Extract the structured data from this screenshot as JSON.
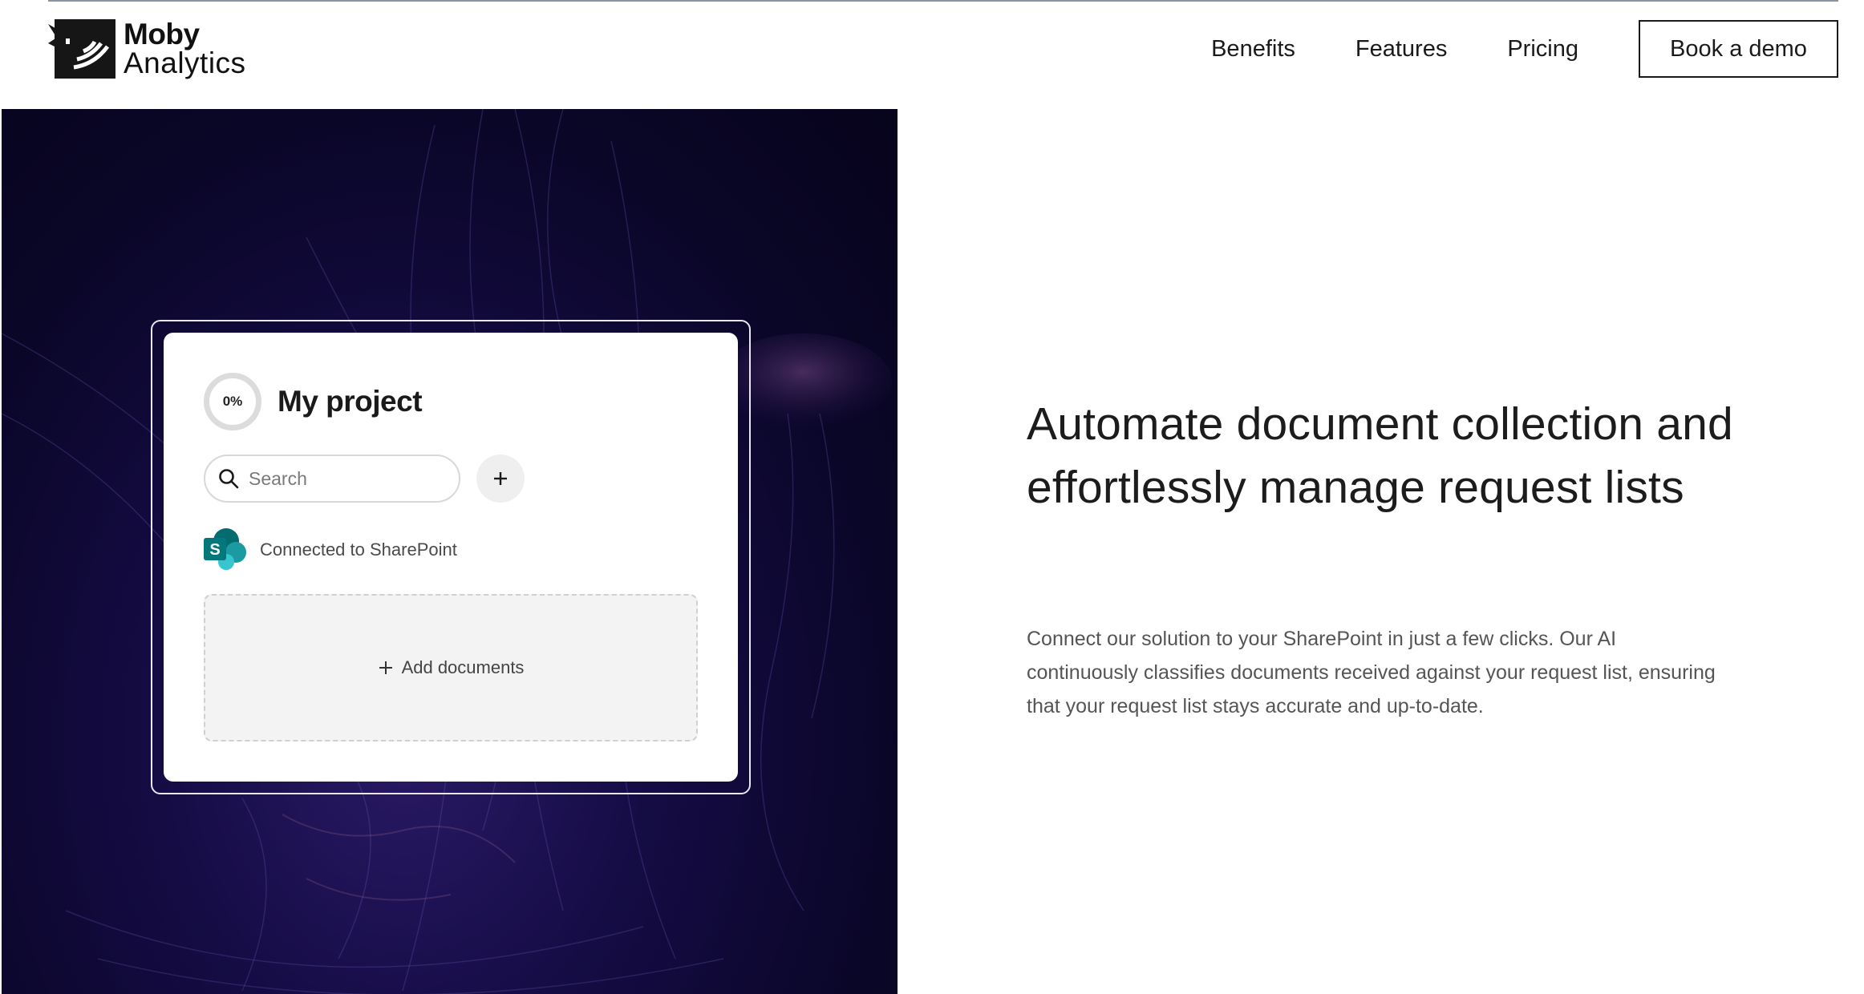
{
  "brand": {
    "name_line1": "Moby",
    "name_line2": "Analytics"
  },
  "nav": {
    "links": [
      "Benefits",
      "Features",
      "Pricing"
    ],
    "cta_label": "Book a demo"
  },
  "project_card": {
    "progress_label": "0%",
    "progress_value": 0,
    "title": "My project",
    "search_placeholder": "Search",
    "integration_status": "Connected to SharePoint",
    "add_documents_label": "Add documents"
  },
  "hero": {
    "headline": "Automate document collection and effortlessly manage request lists",
    "description": "Connect our solution to your SharePoint in just a few clicks. Our AI continuously classifies documents received against your request list, ensuring that your request list stays accurate and up-to-date."
  },
  "colors": {
    "background": "#ffffff",
    "hero_dark": "#0a0628",
    "hero_purple": "#2a1a66",
    "text_primary": "#1c1c1c",
    "text_secondary": "#555555",
    "sharepoint_teal": "#0b7a75"
  },
  "icons": {
    "logo": "whale-logo-icon",
    "search": "search-icon",
    "add": "plus-icon",
    "sharepoint": "sharepoint-icon",
    "add_documents": "plus-icon"
  }
}
